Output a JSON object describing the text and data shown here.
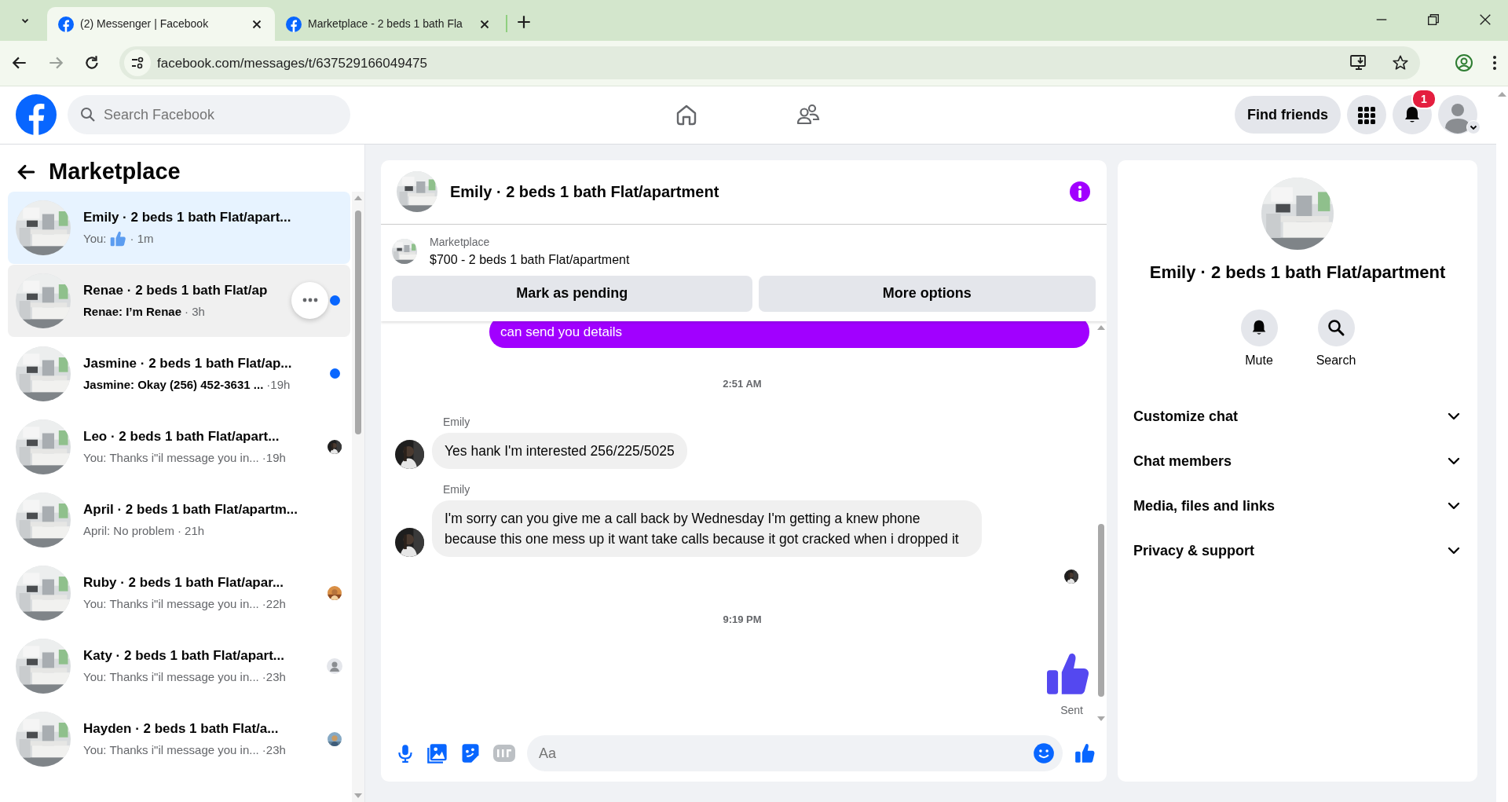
{
  "browser": {
    "tabs": [
      {
        "title": "(2) Messenger | Facebook",
        "selected": true
      },
      {
        "title": "Marketplace - 2 beds 1 bath Fla",
        "selected": false
      }
    ],
    "url": "facebook.com/messages/t/637529166049475"
  },
  "header": {
    "search": {
      "placeholder": "Search Facebook"
    },
    "nav": [
      {
        "kind": "home",
        "selected": false
      },
      {
        "kind": "friends",
        "selected": false
      }
    ],
    "find_friends": "Find friends",
    "notifications": "1"
  },
  "sidebar": {
    "title": "Marketplace",
    "conversations": [
      {
        "title": "Emily · 2 beds 1 bath Flat/apart...",
        "preview": "You:",
        "kind": "like",
        "time": "· 1m",
        "selected": true,
        "hovered": false,
        "unread": false
      },
      {
        "title": "Renae · 2 beds 1 bath Flat/ap",
        "preview": "Renae: I’m Renae",
        "kind": "text",
        "time": "· 3h",
        "selected": false,
        "hovered": true,
        "unread": true
      },
      {
        "title": "Jasmine · 2 beds 1 bath Flat/ap...",
        "preview": "Jasmine: Okay (256) 452-3631 ...",
        "kind": "text",
        "time": "·19h",
        "selected": false,
        "hovered": false,
        "unread": true
      },
      {
        "title": "Leo · 2 beds 1 bath Flat/apart...",
        "preview": "You: Thanks i\"il message you in...",
        "kind": "text",
        "time": "·19h",
        "selected": false,
        "hovered": false,
        "unread": false
      },
      {
        "title": "April · 2 beds 1 bath Flat/apartm...",
        "preview": "April: No problem",
        "kind": "text",
        "time": "· 21h",
        "selected": false,
        "hovered": false,
        "unread": false
      },
      {
        "title": "Ruby · 2 beds 1 bath Flat/apar...",
        "preview": "You: Thanks i\"il message you in...",
        "kind": "text",
        "time": "·22h",
        "selected": false,
        "hovered": false,
        "unread": false
      },
      {
        "title": "Katy · 2 beds 1 bath Flat/apart...",
        "preview": "You: Thanks i\"il message you in...",
        "kind": "text",
        "time": "·23h",
        "selected": false,
        "hovered": false,
        "unread": false,
        "receipt": {
          "kind": "placeholder"
        }
      },
      {
        "title": "Hayden · 2 beds 1 bath Flat/a...",
        "preview": "You: Thanks i\"il message you in...",
        "kind": "text",
        "time": "·23h",
        "selected": false,
        "hovered": false,
        "unread": false
      }
    ]
  },
  "chat": {
    "title": "Emily · 2 beds 1 bath Flat/apartment",
    "listing": {
      "label": "Marketplace",
      "title": "$700 - 2 beds 1 bath Flat/apartment",
      "buttons": [
        "Mark as pending",
        "More options"
      ]
    },
    "messages": [
      {
        "kind": "outgoing",
        "text": "can send you details"
      },
      {
        "kind": "time",
        "text": "2:51 AM"
      },
      {
        "kind": "incoming",
        "sender": "Emily",
        "text": "Yes hank I'm interested 256/225/5025"
      },
      {
        "kind": "incoming",
        "sender": "Emily",
        "text": "I'm sorry can you give me a call back by Wednesday I'm getting a knew phone because this one mess up it want take calls because it got cracked when i dropped it"
      },
      {
        "kind": "seen"
      },
      {
        "kind": "time",
        "text": "9:19 PM"
      },
      {
        "kind": "like",
        "status": "Sent"
      }
    ],
    "composer": {
      "placeholder": "Aa"
    }
  },
  "details": {
    "title": "Emily · 2 beds 1 bath Flat/apartment",
    "actions": [
      {
        "kind": "bell",
        "label": "Mute"
      },
      {
        "kind": "search",
        "label": "Search"
      }
    ],
    "sections": [
      {
        "label": "Customize chat",
        "expanded": false
      },
      {
        "label": "Chat members",
        "expanded": false
      },
      {
        "label": "Media, files and links",
        "expanded": false
      },
      {
        "label": "Privacy & support",
        "expanded": false
      }
    ]
  }
}
